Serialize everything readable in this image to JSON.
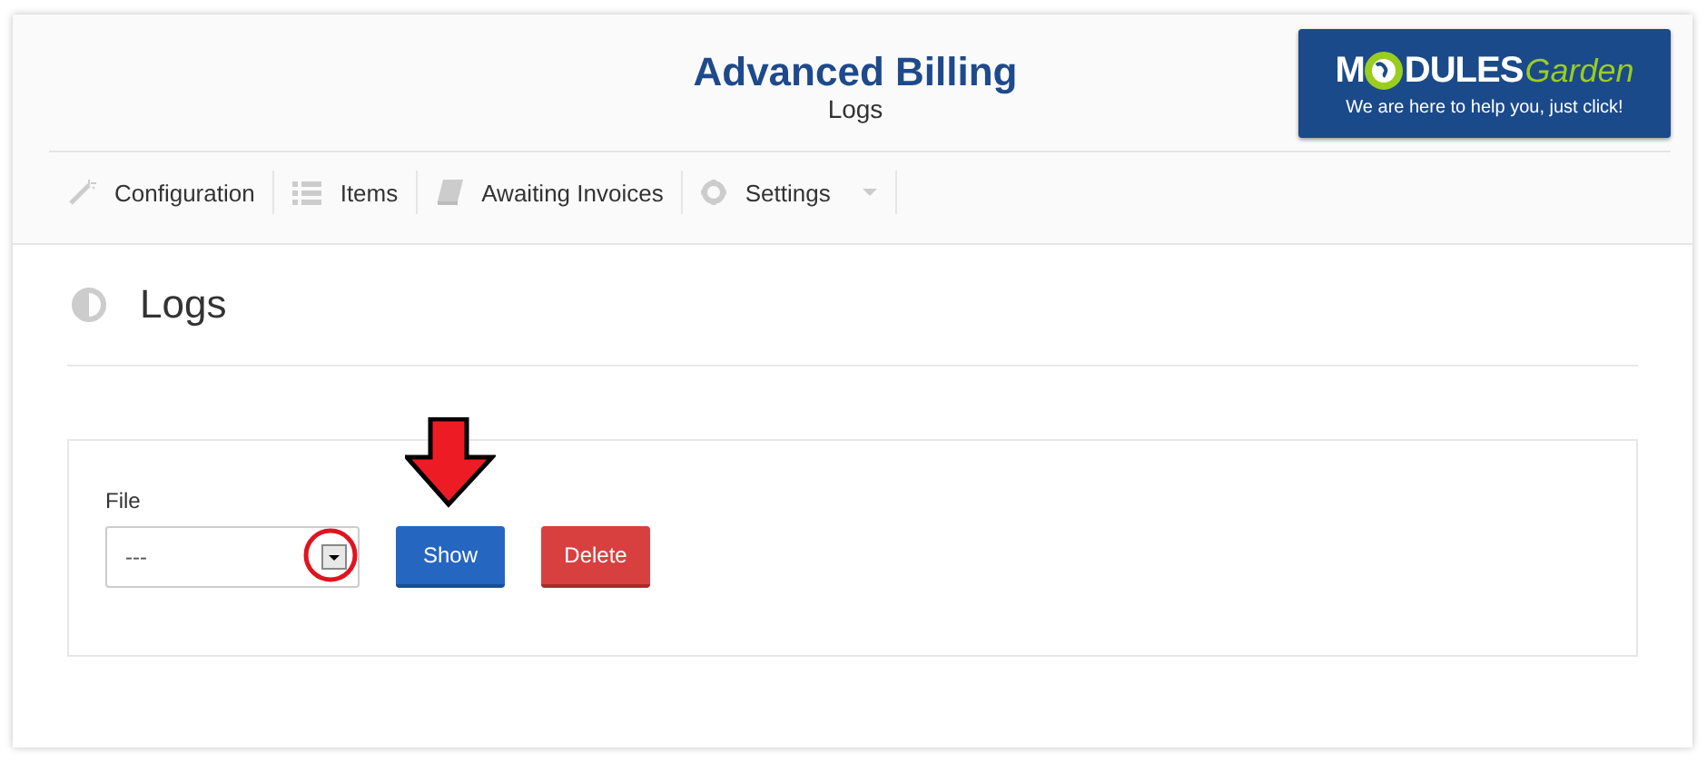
{
  "header": {
    "title": "Advanced Billing",
    "subtitle": "Logs"
  },
  "logo": {
    "lead": "M",
    "rest": "DULES",
    "script": "Garden",
    "tagline": "We are here to help you, just click!"
  },
  "nav": [
    {
      "kind": "wand",
      "label": "Configuration",
      "dropdown": false
    },
    {
      "kind": "list",
      "label": "Items",
      "dropdown": false
    },
    {
      "kind": "book",
      "label": "Awaiting Invoices",
      "dropdown": false
    },
    {
      "kind": "gear",
      "label": "Settings",
      "dropdown": true
    }
  ],
  "page": {
    "title": "Logs"
  },
  "form": {
    "label": "File",
    "select_value": "---",
    "buttons": [
      {
        "kind": "primary",
        "label": "Show"
      },
      {
        "kind": "danger",
        "label": "Delete"
      }
    ]
  }
}
